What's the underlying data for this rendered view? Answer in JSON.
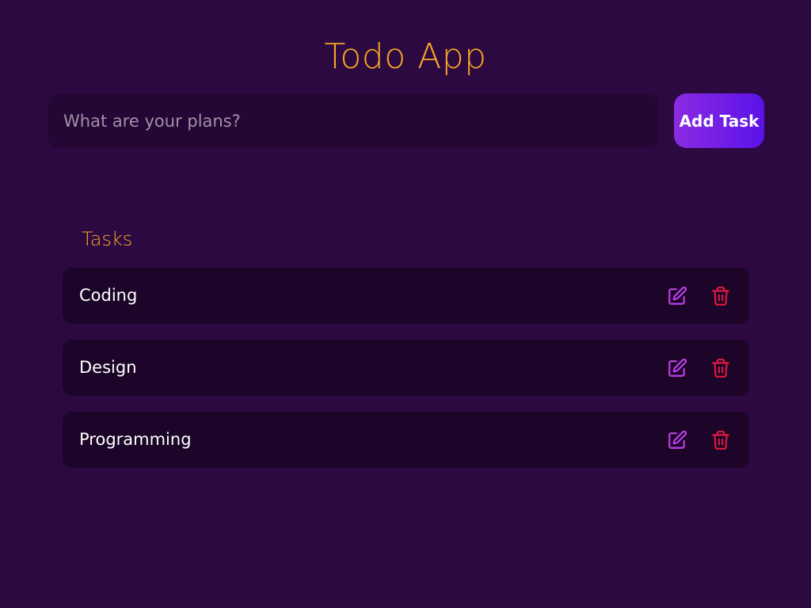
{
  "header": {
    "title": "Todo App"
  },
  "form": {
    "input_value": "",
    "input_placeholder": "What are your plans?",
    "add_label": "Add Task"
  },
  "tasks_section": {
    "heading": "Tasks",
    "items": [
      {
        "label": "Coding",
        "edit_icon": "edit-icon",
        "delete_icon": "trash-icon"
      },
      {
        "label": "Design",
        "edit_icon": "edit-icon",
        "delete_icon": "trash-icon"
      },
      {
        "label": "Programming",
        "edit_icon": "edit-icon",
        "delete_icon": "trash-icon"
      }
    ]
  },
  "colors": {
    "background": "#2d0942",
    "accent": "#f5a623",
    "input_background": "#250735",
    "task_background": "#1c0528",
    "button_gradient_start": "#8b2be2",
    "button_gradient_end": "#5b12e8",
    "edit_icon": "#c13ef0",
    "delete_icon": "#e0193f"
  }
}
